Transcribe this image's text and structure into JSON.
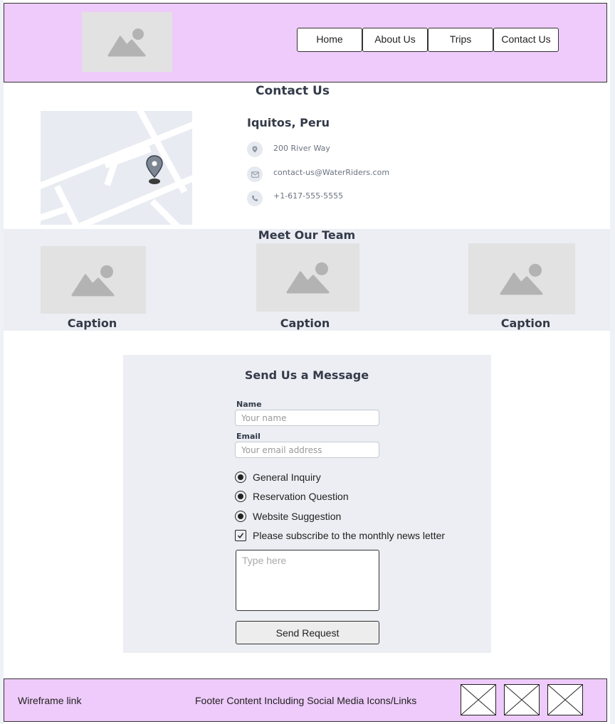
{
  "nav": {
    "items": [
      "Home",
      "About Us",
      "Trips",
      "Contact Us"
    ]
  },
  "contact": {
    "title": "Contact Us",
    "location": "Iquitos, Peru",
    "address": "200 River Way",
    "email": "contact-us@WaterRiders.com",
    "phone": "+1-617-555-5555"
  },
  "team": {
    "title": "Meet Our Team",
    "captions": [
      "Caption",
      "Caption",
      "Caption"
    ]
  },
  "form": {
    "title": "Send Us a Message",
    "name_label": "Name",
    "name_placeholder": "Your name",
    "email_label": "Email",
    "email_placeholder": "Your email address",
    "options": [
      "General Inquiry",
      "Reservation Question",
      "Website Suggestion"
    ],
    "subscribe_label": "Please subscribe to the monthly news letter",
    "subscribe_checked": true,
    "message_placeholder": "Type here",
    "submit_label": "Send Request"
  },
  "footer": {
    "left": "Wireframe link",
    "center": "Footer Content Including Social Media Icons/Links"
  },
  "colors": {
    "header_bg": "#eecbfa",
    "section_bg": "#eceef3",
    "placeholder_img": "#e2e2e2"
  }
}
